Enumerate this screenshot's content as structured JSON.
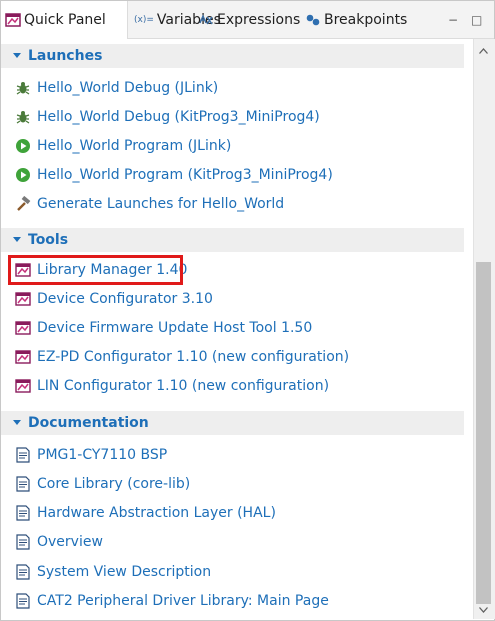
{
  "tabs": [
    {
      "label": "Quick Panel",
      "icon": "quick-panel-icon"
    },
    {
      "label": "Variables",
      "icon": "variables-icon",
      "icon_text": "(x)="
    },
    {
      "label": "Expressions",
      "icon": "expressions-icon"
    },
    {
      "label": "Breakpoints",
      "icon": "breakpoints-icon"
    }
  ],
  "window_controls": {
    "minimize": "−",
    "maximize": "□"
  },
  "sections": [
    {
      "title": "Launches",
      "items": [
        {
          "label": "Hello_World Debug (JLink)",
          "icon": "debug-bug-icon"
        },
        {
          "label": "Hello_World Debug (KitProg3_MiniProg4)",
          "icon": "debug-bug-icon"
        },
        {
          "label": "Hello_World Program (JLink)",
          "icon": "run-program-icon"
        },
        {
          "label": "Hello_World Program (KitProg3_MiniProg4)",
          "icon": "run-program-icon"
        },
        {
          "label": "Generate Launches for Hello_World",
          "icon": "hammer-icon"
        }
      ]
    },
    {
      "title": "Tools",
      "items": [
        {
          "label": "Library Manager 1.40",
          "icon": "tool-window-icon"
        },
        {
          "label": "Device Configurator 3.10",
          "icon": "tool-window-icon"
        },
        {
          "label": "Device Firmware Update Host Tool 1.50",
          "icon": "tool-window-icon"
        },
        {
          "label": "EZ-PD Configurator 1.10 (new configuration)",
          "icon": "tool-window-icon"
        },
        {
          "label": "LIN Configurator 1.10 (new configuration)",
          "icon": "tool-window-icon"
        }
      ]
    },
    {
      "title": "Documentation",
      "items": [
        {
          "label": "PMG1-CY7110 BSP",
          "icon": "document-icon"
        },
        {
          "label": "Core Library (core-lib)",
          "icon": "document-icon"
        },
        {
          "label": "Hardware Abstraction Layer (HAL)",
          "icon": "document-icon"
        },
        {
          "label": "Overview",
          "icon": "document-icon"
        },
        {
          "label": "System View Description",
          "icon": "document-icon"
        },
        {
          "label": "CAT2 Peripheral Driver Library: Main Page",
          "icon": "document-icon"
        }
      ]
    }
  ],
  "colors": {
    "link": "#1e6fb8",
    "highlight_box": "#e01a1a",
    "section_bg": "#eeeeee"
  }
}
